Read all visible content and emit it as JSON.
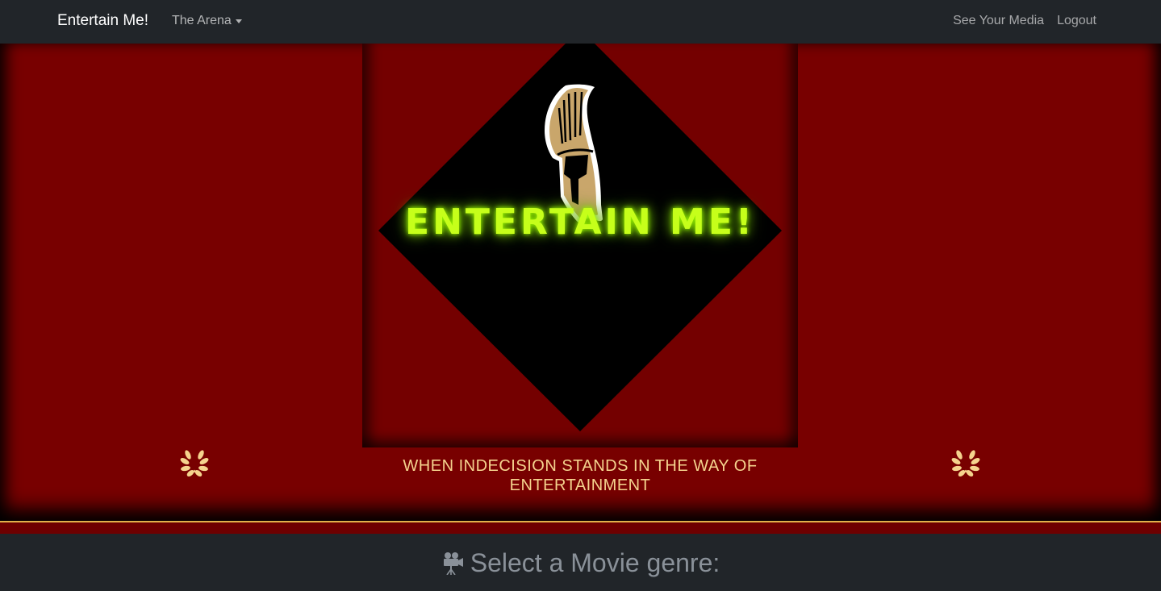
{
  "navbar": {
    "brand": "Entertain Me!",
    "dropdown_label": "The Arena",
    "links": [
      "See Your Media",
      "Logout"
    ]
  },
  "hero": {
    "logo_title": "ENTERTAIN ME!",
    "tagline": "WHEN INDECISION STANDS IN THE WAY OF ENTERTAINMENT"
  },
  "genre_section": {
    "heading": "Select a Movie genre:",
    "icon": "movie-camera-icon"
  },
  "colors": {
    "navbar_bg": "#212529",
    "hero_bg": "#780000",
    "neon_green": "#c6ff1a",
    "gold": "#e2b24a",
    "tagline": "#f5d38e"
  }
}
